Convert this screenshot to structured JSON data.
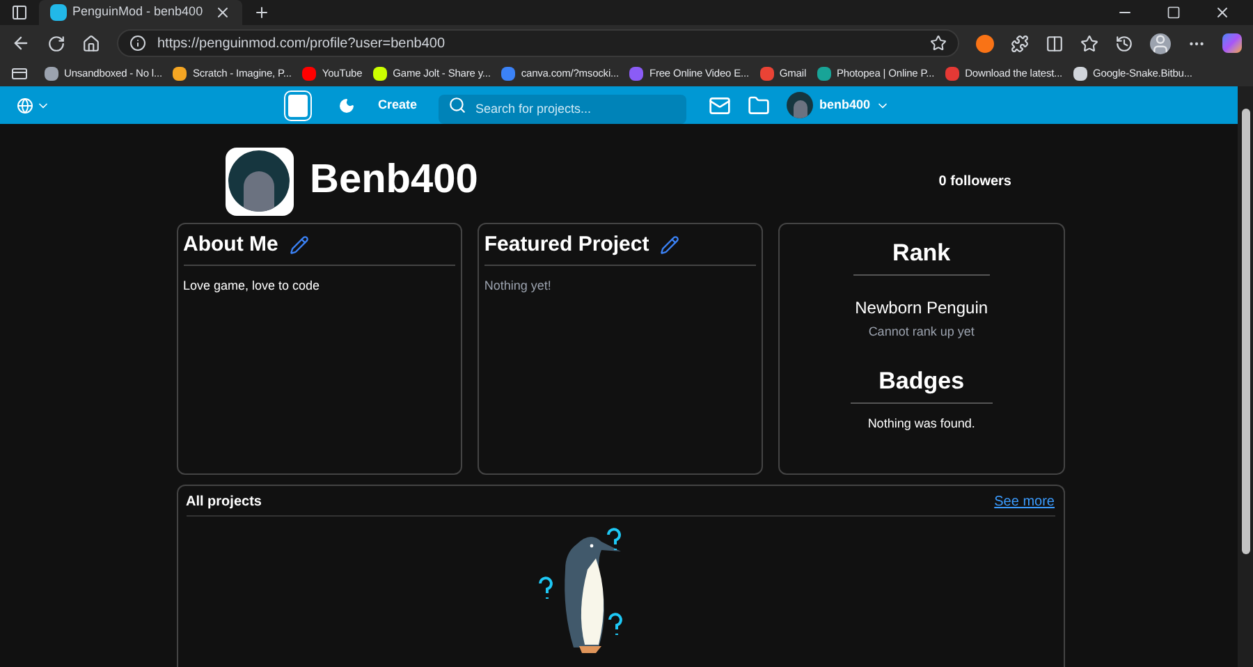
{
  "browser": {
    "tab_title": "PenguinMod - benb400",
    "url": "https://penguinmod.com/profile?user=benb400",
    "bookmarks": [
      {
        "label": "Unsandboxed - No l...",
        "color": "#9ca3af"
      },
      {
        "label": "Scratch - Imagine, P...",
        "color": "#f5a623"
      },
      {
        "label": "YouTube",
        "color": "#ff0000"
      },
      {
        "label": "Game Jolt - Share y...",
        "color": "#ccff00"
      },
      {
        "label": "canva.com/?msocki...",
        "color": "#3b82f6"
      },
      {
        "label": "Free Online Video E...",
        "color": "#8b5cf6"
      },
      {
        "label": "Gmail",
        "color": "#ea4335"
      },
      {
        "label": "Photopea | Online P...",
        "color": "#18a497"
      },
      {
        "label": "Download the latest...",
        "color": "#e53935"
      },
      {
        "label": "Google-Snake.Bitbu...",
        "color": "#d1d5db"
      }
    ]
  },
  "nav": {
    "create": "Create",
    "search": {
      "placeholder": "Search for projects..."
    },
    "username": "benb400"
  },
  "profile": {
    "name": "Benb400",
    "followers": "0 followers"
  },
  "about": {
    "title": "About Me",
    "text": "Love game, love to code"
  },
  "featured": {
    "title": "Featured Project",
    "text": "Nothing yet!"
  },
  "rank": {
    "title": "Rank",
    "rank": "Newborn Penguin",
    "note": "Cannot rank up yet",
    "badges_title": "Badges",
    "badges_text": "Nothing was found."
  },
  "all_projects": {
    "title": "All projects",
    "link": "See more"
  }
}
